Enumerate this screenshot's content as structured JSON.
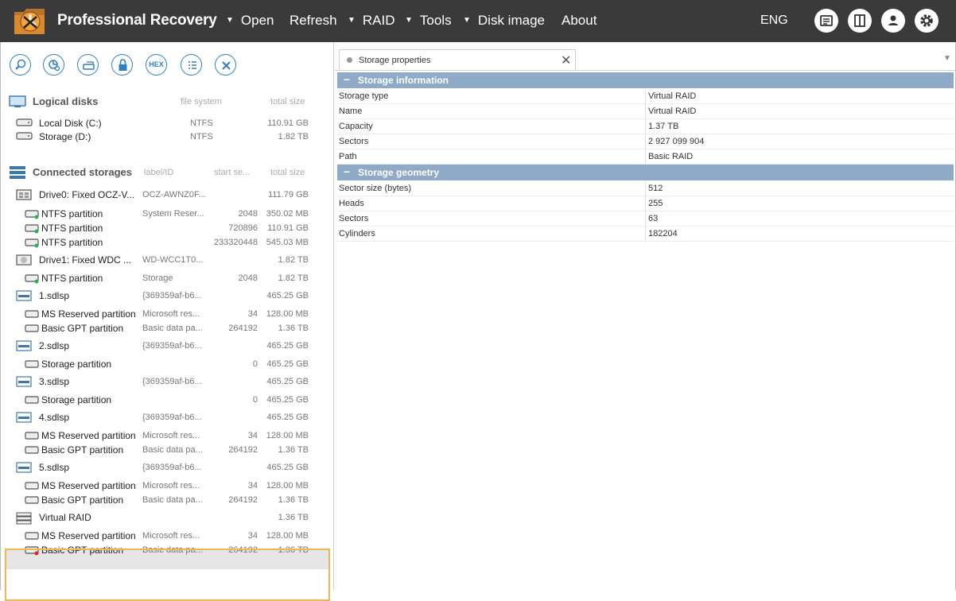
{
  "app": {
    "title": "Professional Recovery"
  },
  "menu": {
    "items": [
      {
        "label": "Open",
        "arrow": true
      },
      {
        "label": "Refresh",
        "arrow": false
      },
      {
        "label": "RAID",
        "arrow": true
      },
      {
        "label": "Tools",
        "arrow": true
      },
      {
        "label": "Disk image",
        "arrow": true
      },
      {
        "label": "About",
        "arrow": false
      }
    ],
    "language": "ENG"
  },
  "toolbar": {
    "hex_label": "HEX"
  },
  "logical_disks": {
    "heading": "Logical disks",
    "col_fs": "file system",
    "col_size": "total size",
    "items": [
      {
        "name": "Local Disk (C:)",
        "fs": "NTFS",
        "size": "110.91 GB"
      },
      {
        "name": "Storage (D:)",
        "fs": "NTFS",
        "size": "1.82 TB"
      }
    ]
  },
  "connected": {
    "heading": "Connected storages",
    "col_label": "label/ID",
    "col_start": "start se...",
    "col_size": "total size",
    "items": [
      {
        "name": "Drive0: Fixed OCZ-V...",
        "label": "OCZ-AWNZ0F...",
        "start": "",
        "size": "111.79 GB",
        "kind": "drive"
      },
      {
        "name": "NTFS partition",
        "label": "System Reser...",
        "start": "2048",
        "size": "350.02 MB",
        "kind": "part-green"
      },
      {
        "name": "NTFS partition",
        "label": "",
        "start": "720896",
        "size": "110.91 GB",
        "kind": "part-green"
      },
      {
        "name": "NTFS partition",
        "label": "",
        "start": "233320448",
        "size": "545.03 MB",
        "kind": "part-green"
      },
      {
        "name": "Drive1: Fixed WDC ...",
        "label": "WD-WCC1T0...",
        "start": "",
        "size": "1.82 TB",
        "kind": "drive2"
      },
      {
        "name": "NTFS partition",
        "label": "Storage",
        "start": "2048",
        "size": "1.82 TB",
        "kind": "part-green"
      },
      {
        "name": "1.sdlsp",
        "label": "{369359af-b6...",
        "start": "",
        "size": "465.25 GB",
        "kind": "image"
      },
      {
        "name": "MS Reserved partition",
        "label": "Microsoft res...",
        "start": "34",
        "size": "128.00 MB",
        "kind": "part"
      },
      {
        "name": "Basic GPT partition",
        "label": "Basic data pa...",
        "start": "264192",
        "size": "1.36 TB",
        "kind": "part"
      },
      {
        "name": "2.sdlsp",
        "label": "{369359af-b6...",
        "start": "",
        "size": "465.25 GB",
        "kind": "image"
      },
      {
        "name": "Storage partition",
        "label": "",
        "start": "0",
        "size": "465.25 GB",
        "kind": "part"
      },
      {
        "name": "3.sdlsp",
        "label": "{369359af-b6...",
        "start": "",
        "size": "465.25 GB",
        "kind": "image"
      },
      {
        "name": "Storage partition",
        "label": "",
        "start": "0",
        "size": "465.25 GB",
        "kind": "part"
      },
      {
        "name": "4.sdlsp",
        "label": "{369359af-b6...",
        "start": "",
        "size": "465.25 GB",
        "kind": "image"
      },
      {
        "name": "MS Reserved partition",
        "label": "Microsoft res...",
        "start": "34",
        "size": "128.00 MB",
        "kind": "part"
      },
      {
        "name": "Basic GPT partition",
        "label": "Basic data pa...",
        "start": "264192",
        "size": "1.36 TB",
        "kind": "part"
      },
      {
        "name": "5.sdlsp",
        "label": "{369359af-b6...",
        "start": "",
        "size": "465.25 GB",
        "kind": "image"
      },
      {
        "name": "MS Reserved partition",
        "label": "Microsoft res...",
        "start": "34",
        "size": "128.00 MB",
        "kind": "part"
      },
      {
        "name": "Basic GPT partition",
        "label": "Basic data pa...",
        "start": "264192",
        "size": "1.36 TB",
        "kind": "part"
      },
      {
        "name": "Virtual RAID",
        "label": "",
        "start": "",
        "size": "1.36 TB",
        "kind": "raid"
      },
      {
        "name": "MS Reserved partition",
        "label": "Microsoft res...",
        "start": "34",
        "size": "128.00 MB",
        "kind": "part"
      },
      {
        "name": "Basic GPT partition",
        "label": "Basic data pa...",
        "start": "264192",
        "size": "1.36 TB",
        "kind": "part-red"
      }
    ]
  },
  "properties": {
    "tab_label": "Storage properties",
    "groups": [
      {
        "title": "Storage information",
        "rows": [
          {
            "key": "Storage type",
            "value": "Virtual RAID"
          },
          {
            "key": "Name",
            "value": "Virtual RAID"
          },
          {
            "key": "Capacity",
            "value": "1.37 TB"
          },
          {
            "key": "Sectors",
            "value": "2 927 099 904"
          },
          {
            "key": "Path",
            "value": "Basic RAID"
          }
        ]
      },
      {
        "title": "Storage geometry",
        "rows": [
          {
            "key": "Sector size (bytes)",
            "value": "512"
          },
          {
            "key": "Heads",
            "value": "255"
          },
          {
            "key": "Sectors",
            "value": "63"
          },
          {
            "key": "Cylinders",
            "value": "182204"
          }
        ]
      }
    ]
  },
  "colors": {
    "accent": "#2f7fc1",
    "group_header": "#8eaac7",
    "selection_border": "#f0b650"
  }
}
